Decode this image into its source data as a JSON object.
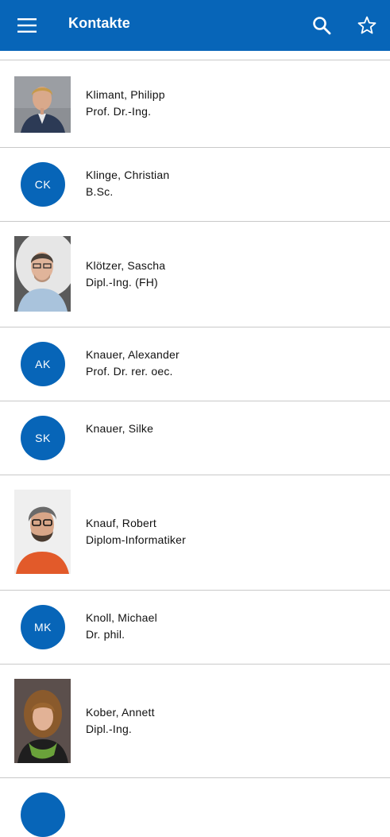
{
  "app_bar": {
    "title": "Kontakte",
    "icons": [
      "menu-icon",
      "search-icon",
      "star-icon"
    ],
    "color": "#0765b8"
  },
  "contacts": [
    {
      "name": "Klimant, Philipp",
      "title": "Prof. Dr.-Ing.",
      "photo": true
    },
    {
      "name": "Klinge, Christian",
      "title": "B.Sc.",
      "initials": "CK"
    },
    {
      "name": "Klötzer, Sascha",
      "title": "Dipl.-Ing. (FH)",
      "photo": true
    },
    {
      "name": "Knauer, Alexander",
      "title": "Prof. Dr. rer. oec.",
      "initials": "AK"
    },
    {
      "name": "Knauer, Silke",
      "title": "",
      "initials": "SK"
    },
    {
      "name": "Knauf, Robert",
      "title": "Diplom-Informatiker",
      "photo": true
    },
    {
      "name": "Knoll, Michael",
      "title": "Dr. phil.",
      "initials": "MK"
    },
    {
      "name": "Kober, Annett",
      "title": "Dipl.-Ing.",
      "photo": true
    }
  ]
}
